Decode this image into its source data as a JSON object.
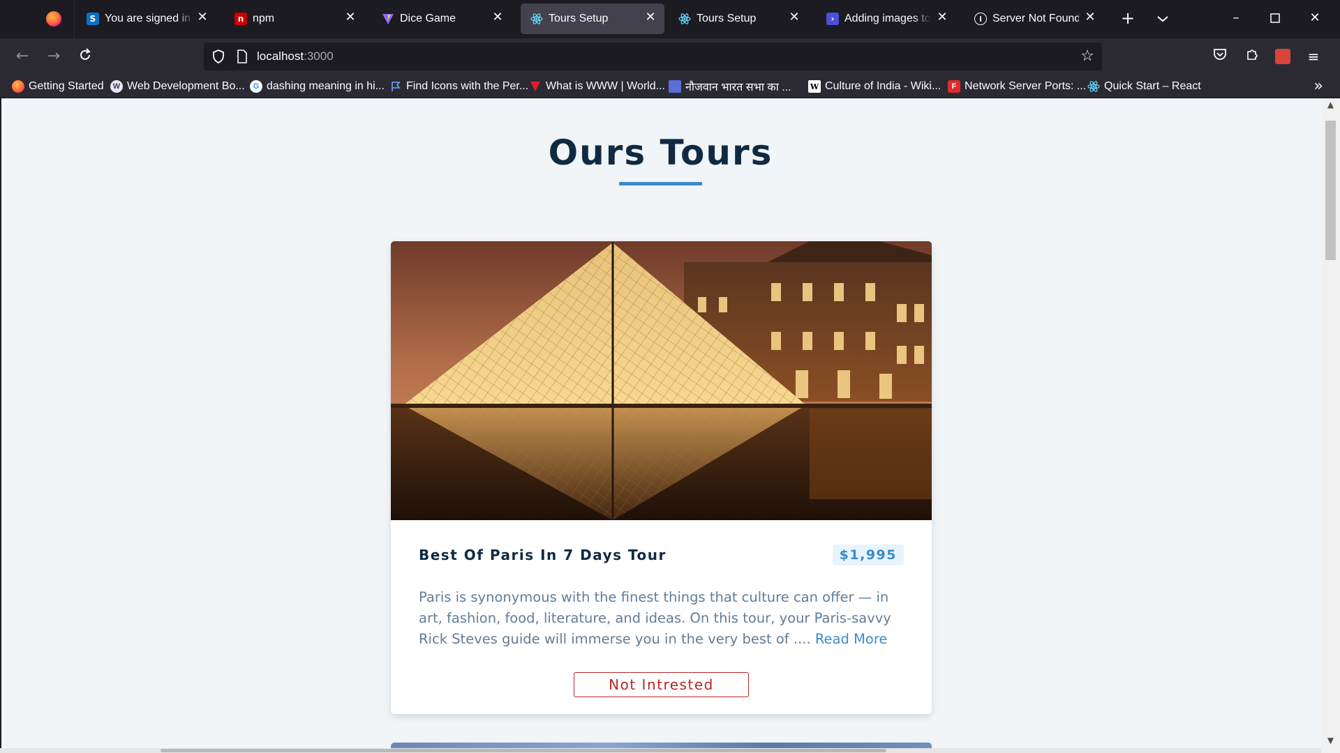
{
  "browser": {
    "tabs": [
      {
        "title": "You are signed in as S",
        "icon": "stackoverflow-s-icon",
        "active": false
      },
      {
        "title": "npm",
        "icon": "npm-icon",
        "active": false
      },
      {
        "title": "Dice Game",
        "icon": "vite-icon",
        "active": false
      },
      {
        "title": "Tours Setup",
        "icon": "react-icon",
        "active": true
      },
      {
        "title": "Tours Setup",
        "icon": "react-icon",
        "active": false
      },
      {
        "title": "Adding images to RE",
        "icon": "code-terminal-icon",
        "active": false
      },
      {
        "title": "Server Not Found",
        "icon": "info-icon",
        "active": false
      }
    ],
    "url_host": "localhost",
    "url_port": ":3000",
    "bookmarks": [
      {
        "label": "Getting Started",
        "icon": "firefox-icon"
      },
      {
        "label": "Web Development Bo...",
        "icon": "web-dev-icon"
      },
      {
        "label": "dashing meaning in hi...",
        "icon": "google-icon"
      },
      {
        "label": "Find Icons with the Per...",
        "icon": "flag-icon"
      },
      {
        "label": "What is WWW | World...",
        "icon": "vivaldi-icon"
      },
      {
        "label": "नौजवान भारत सभा का ...",
        "icon": "emblem-icon"
      },
      {
        "label": "Culture of India - Wiki...",
        "icon": "wikipedia-icon"
      },
      {
        "label": "Network Server Ports: ...",
        "icon": "server-icon"
      },
      {
        "label": "Quick Start – React",
        "icon": "react-icon"
      }
    ]
  },
  "page": {
    "title": "Ours Tours",
    "tours": [
      {
        "name": "Best Of Paris In 7 Days Tour",
        "price": "$1,995",
        "info": "Paris is synonymous with the finest things that culture can offer — in art, fashion, food, literature, and ideas. On this tour, your Paris-savvy Rick Steves guide will immerse you in the very best of ....",
        "read_more": "Read More",
        "not_interested": "Not Intrested"
      }
    ]
  },
  "colors": {
    "heading": "#102a42",
    "accent": "#3b8bc9",
    "danger": "#bb2525",
    "body_text": "#617d98",
    "background": "#f1f5f8"
  }
}
